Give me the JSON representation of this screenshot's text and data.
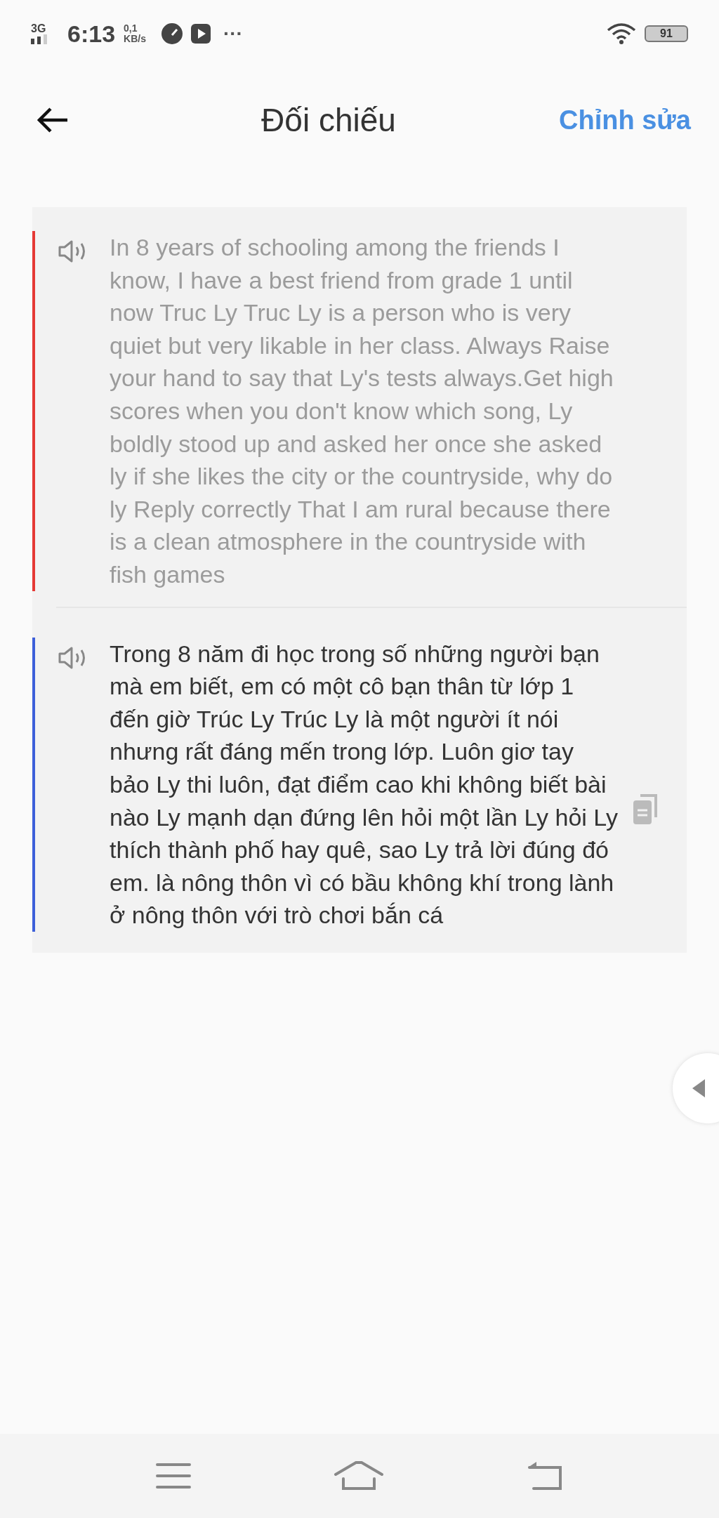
{
  "status_bar": {
    "network": "3G",
    "time": "6:13",
    "speed_value": "0,1",
    "speed_unit": "KB/s",
    "more": "···",
    "battery": "91"
  },
  "header": {
    "title": "Đối chiếu",
    "action": "Chỉnh sửa"
  },
  "blocks": [
    {
      "kind": "source",
      "color": "#e53935",
      "text": "In 8 years of schooling among the friends I know, I have a best friend from grade 1 until now Truc Ly Truc Ly is a person who is very quiet but very likable in her class. Always Raise your hand to say that Ly's tests always.Get high scores when you don't know which song, Ly boldly stood up and asked her once she asked ly if she likes the city or the countryside, why do ly Reply correctly That I am rural because there is a clean atmosphere in the countryside with fish games"
    },
    {
      "kind": "translation",
      "color": "#3d5fd9",
      "text": "Trong 8 năm đi học trong số những người bạn mà em biết, em có một cô bạn thân từ lớp 1 đến giờ Trúc Ly Trúc Ly là một người ít nói nhưng rất đáng mến trong lớp. Luôn giơ tay bảo Ly thi luôn, đạt điểm cao khi không biết bài nào Ly mạnh dạn đứng lên hỏi một lần Ly hỏi Ly thích thành phố hay quê, sao Ly trả lời đúng đó em. là nông thôn vì có bầu không khí trong lành ở nông thôn với trò chơi bắn cá"
    }
  ]
}
